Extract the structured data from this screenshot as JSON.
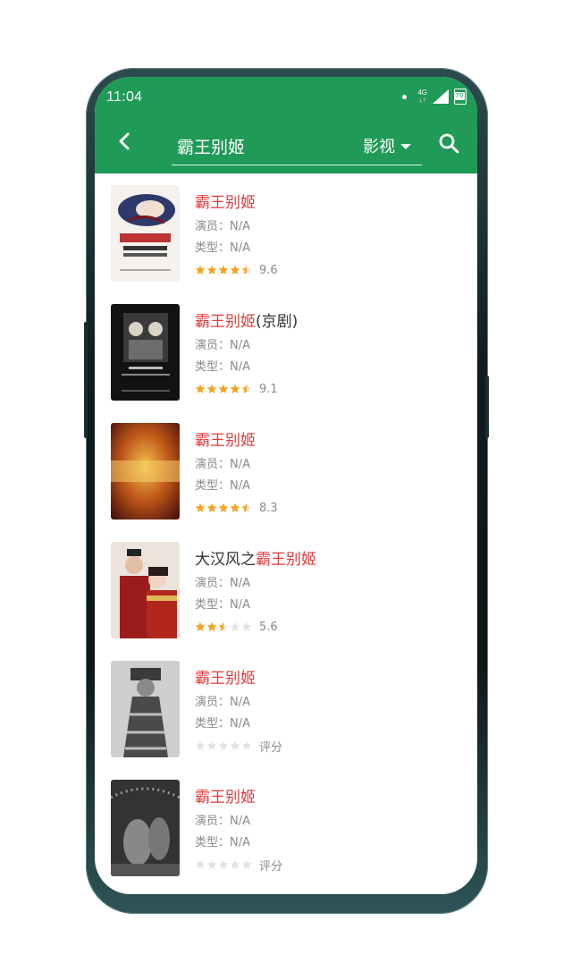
{
  "status_bar": {
    "time": "11:04",
    "network": "4G",
    "battery": "70"
  },
  "toolbar": {
    "query": "霸王别姬",
    "category": "影视"
  },
  "labels": {
    "actor": "演员：",
    "genre": "类型：",
    "no_rating": "评分"
  },
  "colors": {
    "primary": "#1f9a57",
    "highlight": "#e23a3a",
    "star_on": "#f4a423",
    "star_off": "#e3e3e3"
  },
  "results": [
    {
      "pre": "",
      "hl": "霸王别姬",
      "post": "",
      "actor": "N/A",
      "genre": "N/A",
      "stars": 4.5,
      "score": "9.6"
    },
    {
      "pre": "",
      "hl": "霸王别姬",
      "post": "(京剧)",
      "actor": "N/A",
      "genre": "N/A",
      "stars": 4.5,
      "score": "9.1"
    },
    {
      "pre": "",
      "hl": "霸王别姬",
      "post": "",
      "actor": "N/A",
      "genre": "N/A",
      "stars": 4.5,
      "score": "8.3"
    },
    {
      "pre": "大汉风之",
      "hl": "霸王别姬",
      "post": "",
      "actor": "N/A",
      "genre": "N/A",
      "stars": 2.5,
      "score": "5.6"
    },
    {
      "pre": "",
      "hl": "霸王别姬",
      "post": "",
      "actor": "N/A",
      "genre": "N/A",
      "stars": 0,
      "score": "评分"
    },
    {
      "pre": "",
      "hl": "霸王别姬",
      "post": "",
      "actor": "N/A",
      "genre": "N/A",
      "stars": 0,
      "score": "评分"
    }
  ]
}
